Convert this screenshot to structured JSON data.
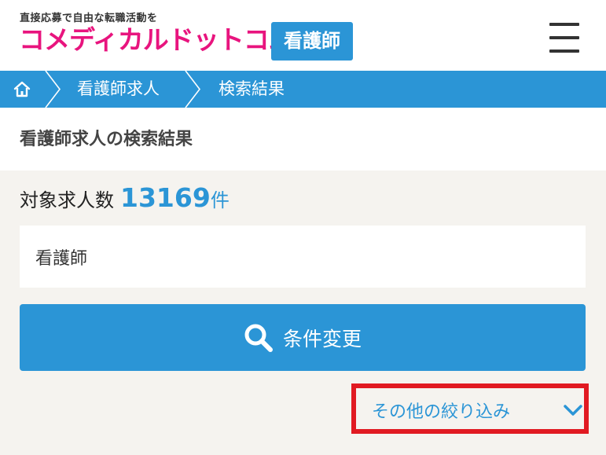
{
  "header": {
    "tagline": "直接応募で自由な転職活動を",
    "logo_text": "コメディカルドットコム",
    "logo_badge": "看護師"
  },
  "breadcrumb": {
    "items": [
      {
        "label": "看護師求人"
      },
      {
        "label": "検索結果"
      }
    ]
  },
  "page": {
    "title": "看護師求人の検索結果"
  },
  "results": {
    "count_label": "対象求人数",
    "count_value": "13169",
    "count_unit": "件"
  },
  "search": {
    "keyword_value": "看護師",
    "button_label": "条件変更"
  },
  "filter": {
    "toggle_label": "その他の絞り込み"
  },
  "colors": {
    "brand_pink": "#e8147e",
    "brand_blue": "#2b95d6",
    "highlight_red": "#e11a22",
    "background": "#f5f3ef"
  },
  "icons": [
    "home-icon",
    "hamburger-menu-icon",
    "search-icon",
    "chevron-down-icon"
  ]
}
